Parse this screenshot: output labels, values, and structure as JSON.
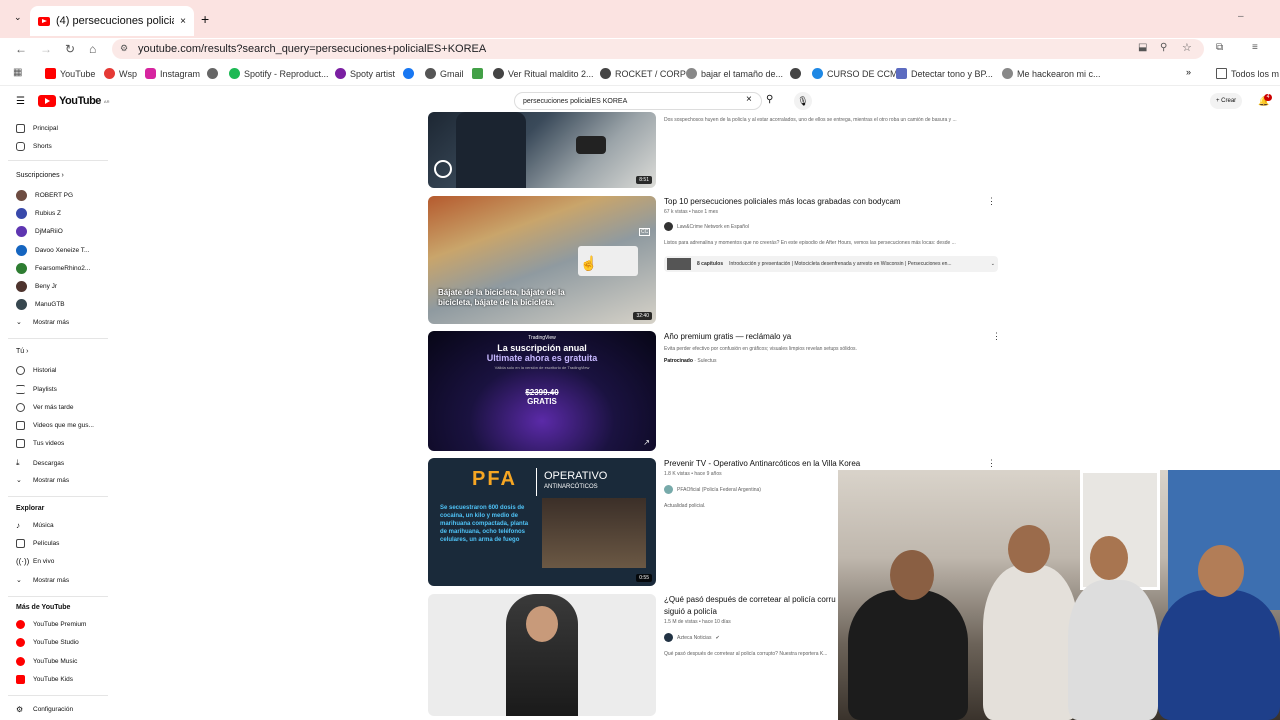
{
  "browser": {
    "tab_title": "(4) persecuciones policialES KO",
    "url": "youtube.com/results?search_query=persecuciones+policialES+KOREA",
    "bookmarks": [
      "YouTube",
      "Wsp",
      "Instagram",
      "Spotify - Reproduct...",
      "Spoty artist",
      "Gmail",
      "Ver Ritual maldito 2...",
      "ROCKET / CORP",
      "bajar el tamaño de...",
      "CURSO DE CCM",
      "Detectar tono y BP...",
      "Me hackearon mi c..."
    ],
    "bookmarks_folder": "Todos los m"
  },
  "youtube": {
    "logo_text": "YouTube",
    "logo_sup": "AR",
    "search_query": "persecuciones policialES KOREA",
    "create_label": "Crear",
    "notif_count": "4"
  },
  "sidebar": {
    "home": "Principal",
    "shorts": "Shorts",
    "subs_header": "Suscripciones",
    "subscriptions": [
      "ROBERT PG",
      "Rubius Z",
      "DjMaRiiO",
      "Davoo Xeneize T...",
      "FearsomeRhino2...",
      "Beny Jr",
      "ManuGTB"
    ],
    "show_more": "Mostrar más",
    "you_header": "Tú",
    "you_items": [
      "Historial",
      "Playlists",
      "Ver más tarde",
      "Videos que me gus...",
      "Tus videos",
      "Descargas"
    ],
    "explore_header": "Explorar",
    "explore_items": [
      "Música",
      "Películas",
      "En vivo"
    ],
    "more_header": "Más de YouTube",
    "more_items": [
      "YouTube Premium",
      "YouTube Studio",
      "YouTube Music",
      "YouTube Kids"
    ],
    "settings": "Configuración"
  },
  "results": [
    {
      "title": "",
      "desc": "Dos sospechosos huyen de la policía y al estar acorralados, uno de ellos se entrega, mientras el otro roba un camión de basura y ...",
      "duration": "8:51"
    },
    {
      "title": "Top 10 persecuciones policiales más locas grabadas con bodycam",
      "meta": "67 k vistas • hace 1 mes",
      "channel": "Law&Crime Network en Español",
      "desc": "Listos para adrenalina y momentos que no creerás? En este episodio de After Hours, vemos las persecuciones más locas: desde ...",
      "chapters_label": "8 capítulos",
      "chapters": "Introducción y presentación | Motocicleta desenfrenada y arresto en Wisconsin | Persecuciones en...",
      "caption": "Bájate de la bicicleta, bájate de la bicicleta, bájate de la bicicleta.",
      "duration": "32:40"
    },
    {
      "title": "Año premium gratis — reclámalo ya",
      "desc": "Evita perder efectivo por confusión en gráficos; visuales limpios revelan setups sólidos.",
      "sponsored": "Patrocinado",
      "sponsor": "Sulectus",
      "ad_brand": "TradingView",
      "ad_line1": "La suscripción anual",
      "ad_line2": "Ultimate ahora es gratuita",
      "ad_sub": "Válida solo en la versión de escritorio de TradingView",
      "ad_price": "$2399.40",
      "ad_free": "GRATIS"
    },
    {
      "title": "Prevenir TV - Operativo Antinarcóticos en la Villa Korea",
      "meta": "1.8 K vistas • hace 9 años",
      "channel": "PFAOficial (Policía Federal Argentina)",
      "desc": "Actualidad policial.",
      "thumb_brand": "PFA",
      "thumb_title": "OPERATIVO",
      "thumb_sub": "ANTINARCÓTICOS",
      "thumb_text": "Se secuestraron 600 dosis de cocaína, un kilo y medio de marihuana compactada, planta de marihuana, ocho teléfonos celulares, un arma de fuego",
      "duration": "0:55"
    },
    {
      "title": "¿Qué pasó después de corretear al policía corru",
      "title2": "siguió a policía",
      "meta": "1.5 M de vistas • hace 10 días",
      "channel": "Azteca Noticias",
      "desc": "Qué pasó después de corretear al policía corrupto? Nuestra reportera K..."
    }
  ],
  "colors": {
    "accent": "#ff0000",
    "tabstrip": "#fbe3e1"
  }
}
